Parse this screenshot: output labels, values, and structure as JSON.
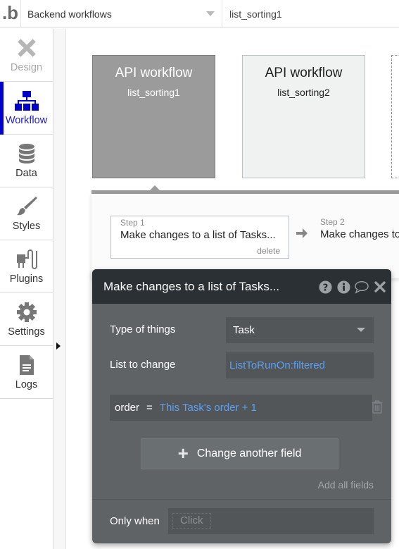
{
  "topbar": {
    "logo": "b",
    "page_selector": "Backend workflows",
    "current_workflow": "list_sorting1"
  },
  "sidebar": {
    "items": [
      {
        "label": "Design",
        "icon": "design-icon",
        "state": "disabled"
      },
      {
        "label": "Workflow",
        "icon": "workflow-icon",
        "state": "active"
      },
      {
        "label": "Data",
        "icon": "database-icon",
        "state": "normal"
      },
      {
        "label": "Styles",
        "icon": "brush-icon",
        "state": "normal"
      },
      {
        "label": "Plugins",
        "icon": "plug-icon",
        "state": "normal"
      },
      {
        "label": "Settings",
        "icon": "gear-icon",
        "state": "normal"
      },
      {
        "label": "Logs",
        "icon": "document-icon",
        "state": "normal"
      }
    ]
  },
  "workflows": [
    {
      "title": "API workflow",
      "name": "list_sorting1",
      "selected": true
    },
    {
      "title": "API workflow",
      "name": "list_sorting2",
      "selected": false
    }
  ],
  "steps": [
    {
      "number": "Step 1",
      "title": "Make changes to a list of Tasks...",
      "delete_label": "delete"
    },
    {
      "number": "Step 2",
      "title": "Make changes to"
    }
  ],
  "editor": {
    "title": "Make changes to a list of Tasks...",
    "header_icons": [
      "help-icon",
      "info-icon",
      "comment-icon",
      "close-icon"
    ],
    "type_of_things_label": "Type of things",
    "type_of_things_value": "Task",
    "list_to_change_label": "List to change",
    "list_to_change_value": "ListToRunOn:filtered",
    "field_change": {
      "field": "order",
      "operator": "=",
      "expression": "This Task's order + 1"
    },
    "change_another_label": "Change another field",
    "add_all_label": "Add all fields",
    "only_when_label": "Only when",
    "only_when_placeholder": "Click"
  },
  "colors": {
    "active_nav": "#0000cc",
    "dynamic_expression": "#5aa0f2",
    "editor_header": "#2a3033",
    "editor_body": "#5f6366",
    "selected_card": "#9b9b9b"
  }
}
